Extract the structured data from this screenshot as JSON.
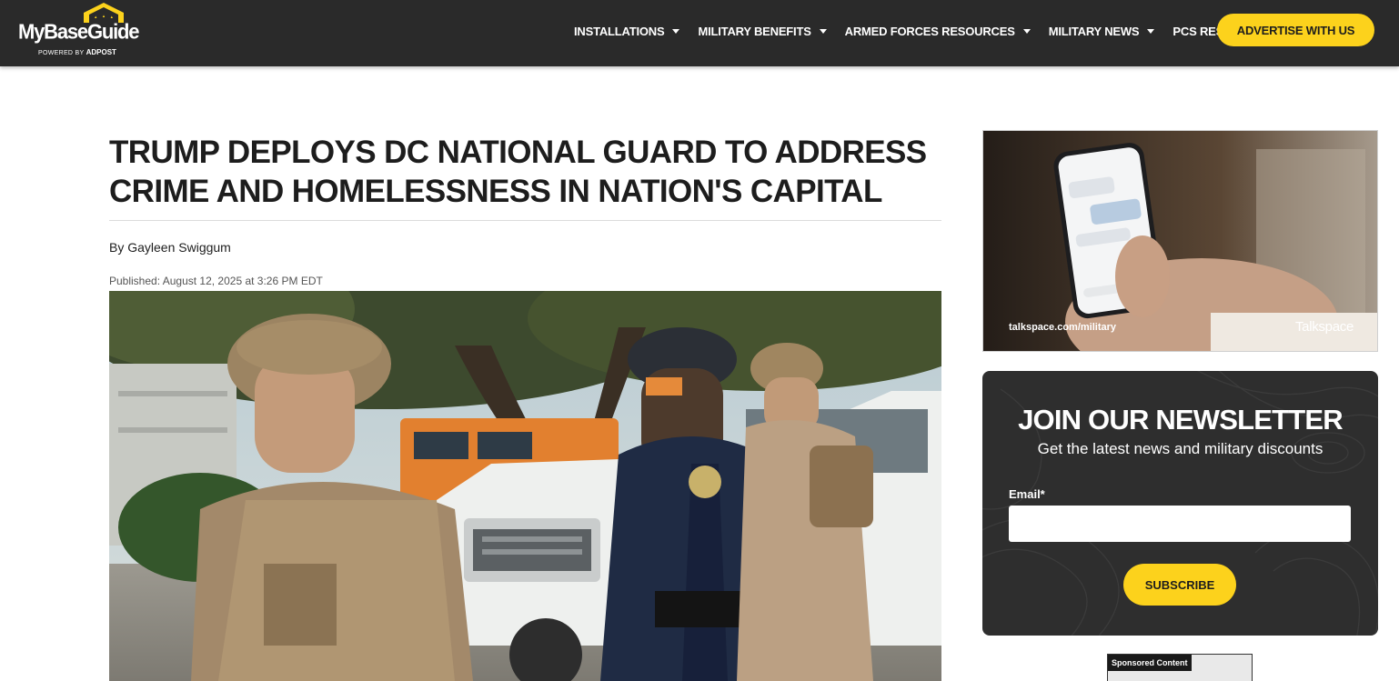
{
  "header": {
    "logo_text": "MyBaseGuide",
    "logo_sub_prefix": "POWERED BY",
    "logo_sub_brand": "ADPOST",
    "nav": [
      {
        "label": "INSTALLATIONS"
      },
      {
        "label": "MILITARY BENEFITS"
      },
      {
        "label": "ARMED FORCES RESOURCES"
      },
      {
        "label": "MILITARY NEWS"
      },
      {
        "label": "PCS RESOURCES"
      }
    ],
    "advertise_label": "ADVERTISE WITH US",
    "colors": {
      "bar": "#2a2a2a",
      "accent": "#fcd21c"
    }
  },
  "article": {
    "headline": "TRUMP DEPLOYS DC NATIONAL GUARD TO ADDRESS CRIME AND HOMELESSNESS IN NATION'S CAPITAL",
    "byline": "By Gayleen Swiggum",
    "published": "Published: August 12, 2025 at 3:26 PM EDT"
  },
  "sidebar": {
    "ad": {
      "url": "talkspace.com/military",
      "brand": "Talkspace"
    },
    "newsletter": {
      "title": "JOIN OUR NEWSLETTER",
      "subtitle": "Get the latest news and military discounts",
      "email_label": "Email*",
      "email_value": "",
      "subscribe_label": "SUBSCRIBE"
    },
    "sponsored_label": "Sponsored Content"
  }
}
